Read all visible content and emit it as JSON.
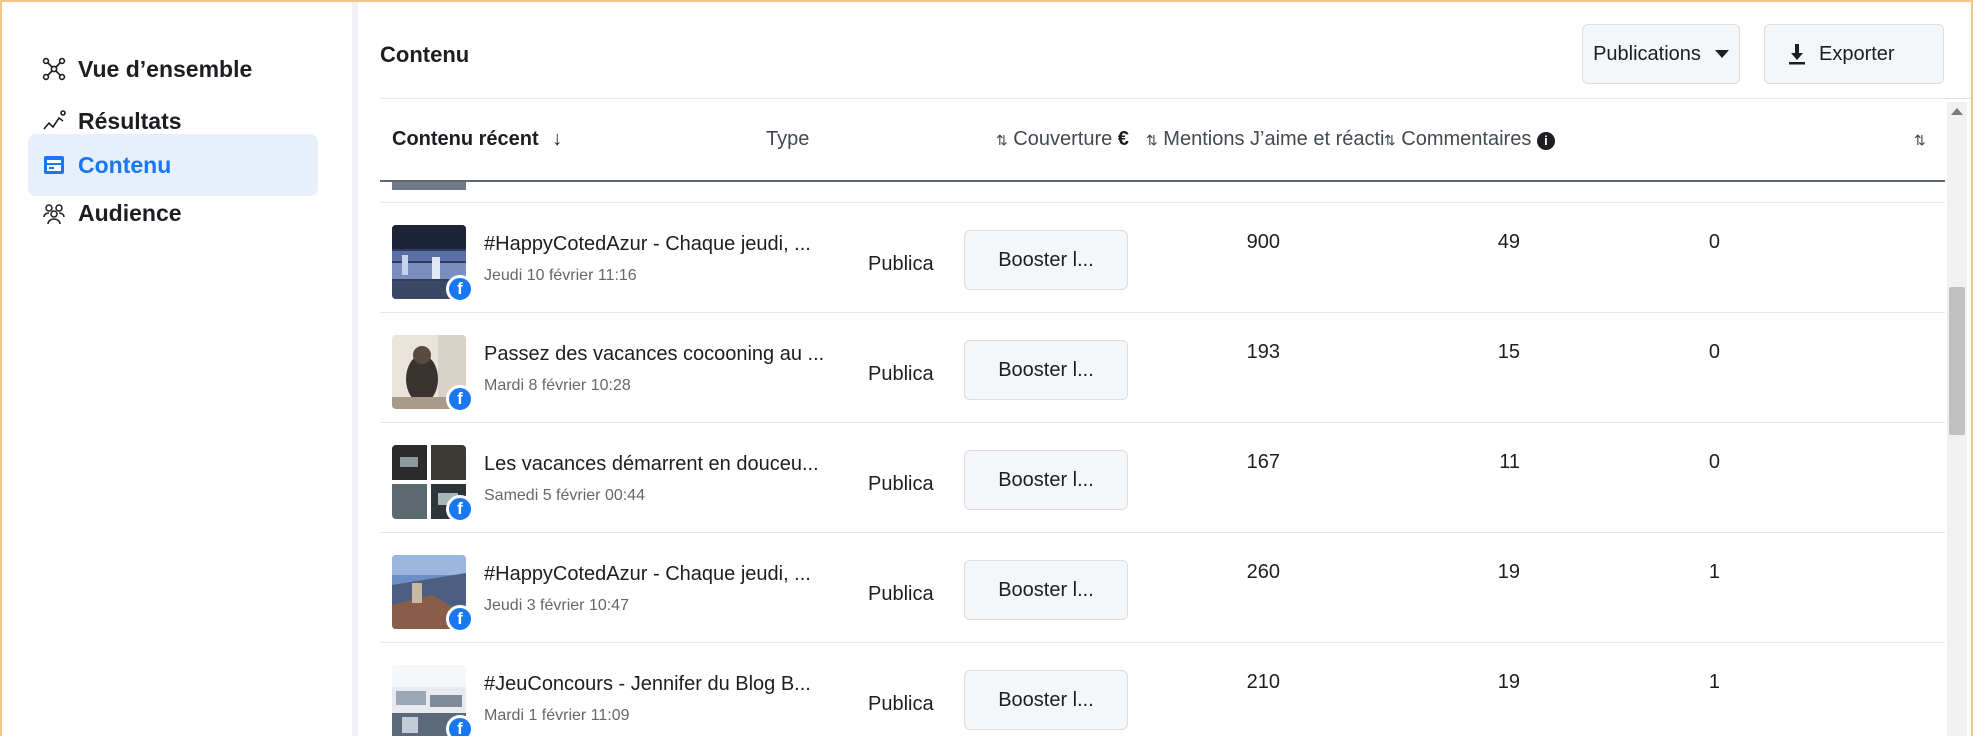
{
  "sidebar": {
    "items": [
      {
        "label": "Vue d’ensemble",
        "icon": "overview-icon",
        "active": false
      },
      {
        "label": "Résultats",
        "icon": "results-icon",
        "active": false
      },
      {
        "label": "Contenu",
        "icon": "content-icon",
        "active": true
      },
      {
        "label": "Audience",
        "icon": "audience-icon",
        "active": false
      }
    ]
  },
  "main": {
    "title": "Contenu",
    "publications_button": "Publications",
    "export_button": "Exporter"
  },
  "table": {
    "columns": {
      "recent": "Contenu récent",
      "type": "Type",
      "reach": "Couverture",
      "reactions": "Mentions J’aime et réacti",
      "comments": "Commentaires"
    },
    "rows": [
      {
        "title": "#HappyCotedAzur - Chaque jeudi, ...",
        "date": "Jeudi 10 février 11:16",
        "type": "Publica",
        "boost": "Booster l...",
        "reach": "900",
        "reactions": "49",
        "comments": "0"
      },
      {
        "title": "Passez des vacances cocooning au ...",
        "date": "Mardi 8 février 10:28",
        "type": "Publica",
        "boost": "Booster l...",
        "reach": "193",
        "reactions": "15",
        "comments": "0"
      },
      {
        "title": "Les vacances démarrent en douceu...",
        "date": "Samedi 5 février 00:44",
        "type": "Publica",
        "boost": "Booster l...",
        "reach": "167",
        "reactions": "11",
        "comments": "0"
      },
      {
        "title": "#HappyCotedAzur - Chaque jeudi, ...",
        "date": "Jeudi 3 février 10:47",
        "type": "Publica",
        "boost": "Booster l...",
        "reach": "260",
        "reactions": "19",
        "comments": "1"
      },
      {
        "title": "#JeuConcours - Jennifer du Blog B...",
        "date": "Mardi 1 février 11:09",
        "type": "Publica",
        "boost": "Booster l...",
        "reach": "210",
        "reactions": "19",
        "comments": "1"
      }
    ]
  },
  "colors": {
    "accent": "#1877f2",
    "active_bg": "#e7f0fa",
    "frame": "#f2c58c"
  }
}
